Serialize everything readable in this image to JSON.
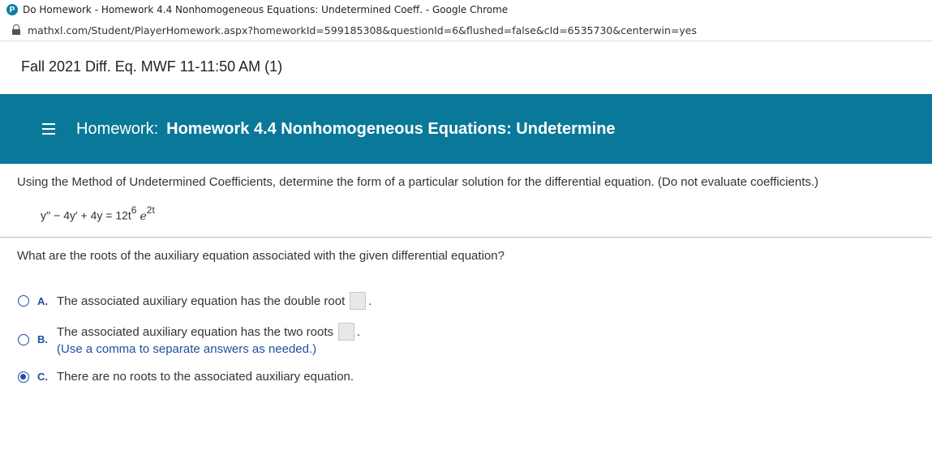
{
  "browser": {
    "window_title": "Do Homework - Homework 4.4 Nonhomogeneous Equations: Undetermined Coeff. - Google Chrome",
    "favicon_letter": "P",
    "url": "mathxl.com/Student/PlayerHomework.aspx?homeworkId=599185308&questionId=6&flushed=false&cId=6535730&centerwin=yes"
  },
  "course": {
    "title": "Fall 2021 Diff. Eq. MWF 11-11:50 AM (1)"
  },
  "homework_bar": {
    "label": "Homework:",
    "title": "Homework 4.4 Nonhomogeneous Equations: Undetermine"
  },
  "problem": {
    "instruction": "Using the Method of Undetermined Coefficients, determine the form of a particular solution for the differential equation. (Do not evaluate coefficients.)",
    "equation_main": "y′′ − 4y′ + 4y = 12t",
    "equation_t_exp": "6",
    "equation_e": "e",
    "equation_e_exp": "2t"
  },
  "question": {
    "text": "What are the roots of the auxiliary equation associated with the given differential equation?",
    "selected": "C",
    "options": [
      {
        "letter": "A.",
        "text": "The associated auxiliary equation has the double root",
        "suffix": "."
      },
      {
        "letter": "B.",
        "text": "The associated auxiliary equation has the two roots",
        "suffix": ".",
        "note": "(Use a comma to separate answers as needed.)"
      },
      {
        "letter": "C.",
        "text": "There are no roots to the associated auxiliary equation."
      }
    ]
  },
  "colors": {
    "header_bar": "#0a7899",
    "option_accent": "#1f4fa0"
  }
}
